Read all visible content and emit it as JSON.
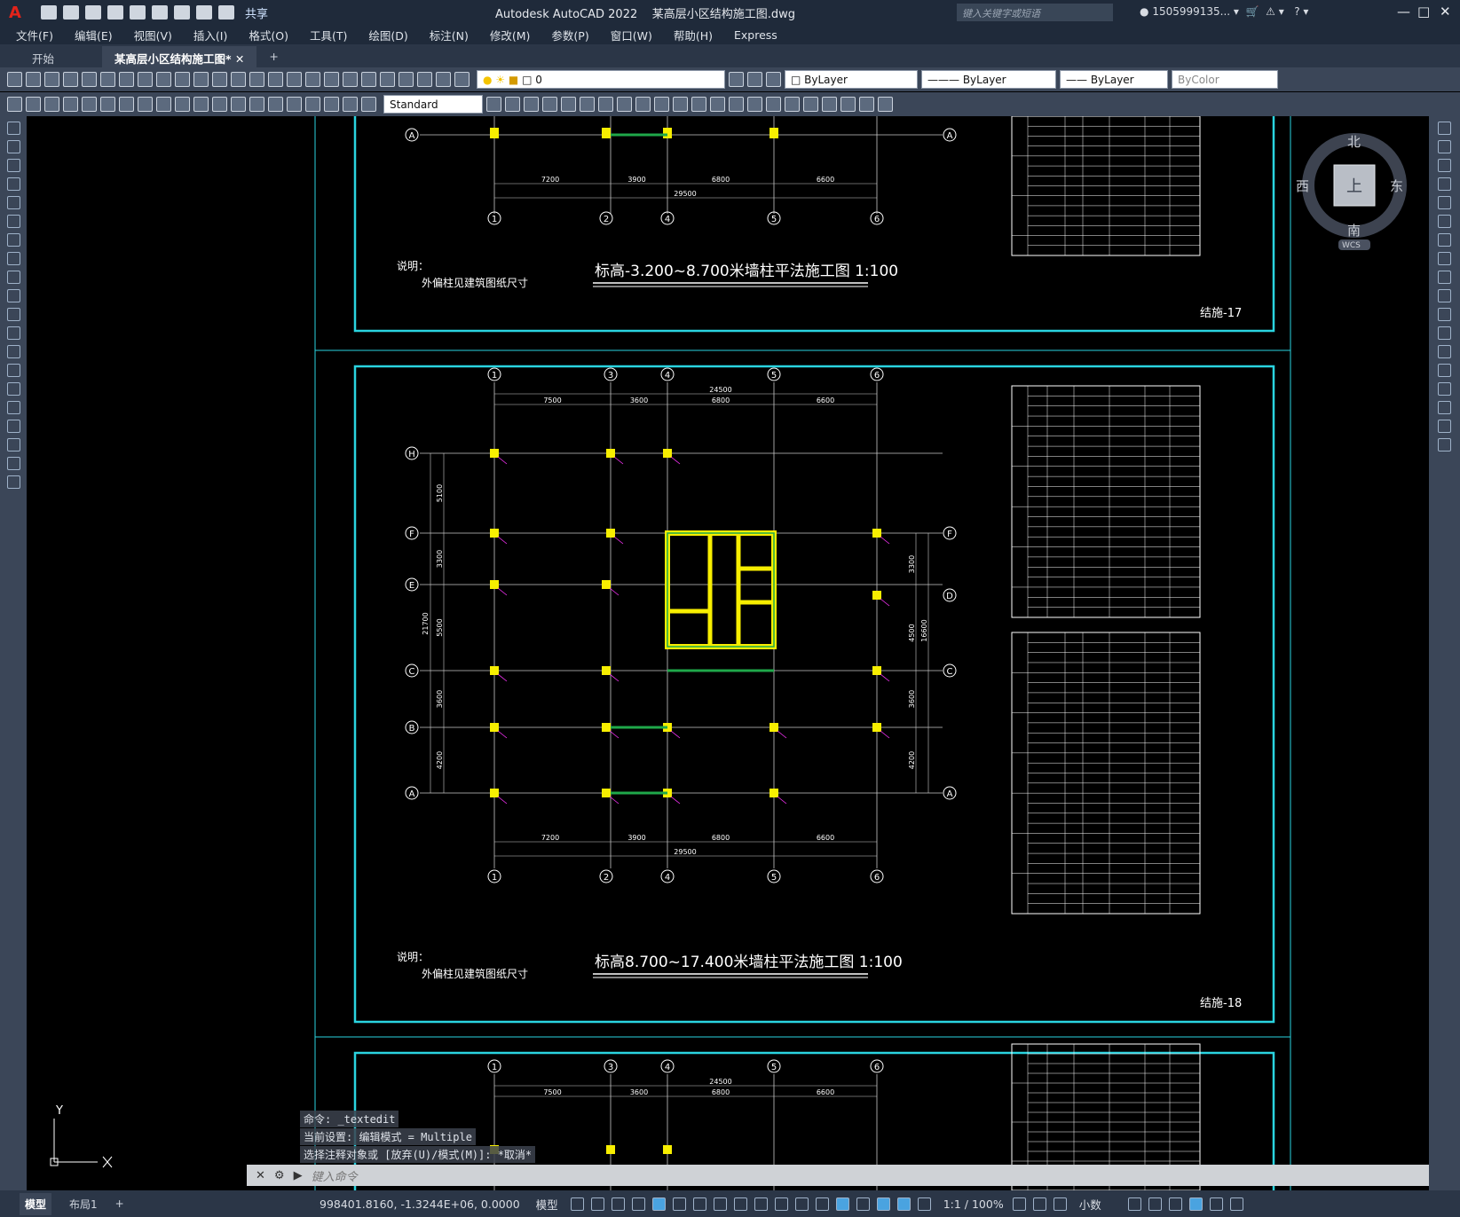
{
  "app": {
    "logo": "A",
    "title": "Autodesk AutoCAD 2022",
    "filename": "某高层小区结构施工图.dwg",
    "share": "共享",
    "search_placeholder": "键入关键字或短语",
    "user": "1505999135...",
    "help": "?"
  },
  "menu": [
    "文件(F)",
    "编辑(E)",
    "视图(V)",
    "插入(I)",
    "格式(O)",
    "工具(T)",
    "绘图(D)",
    "标注(N)",
    "修改(M)",
    "参数(P)",
    "窗口(W)",
    "帮助(H)",
    "Express"
  ],
  "tabs": {
    "start": "开始",
    "doc": "某高层小区结构施工图*",
    "add": "+"
  },
  "toolbar": {
    "layer": "0",
    "color": "ByLayer",
    "linetype": "ByLayer",
    "lineweight": "ByLayer",
    "plotstyle": "ByColor",
    "textstyle": "Standard"
  },
  "viewcube": {
    "north": "北",
    "south": "南",
    "east": "东",
    "west": "西",
    "top": "上",
    "wcs": "WCS"
  },
  "drawing": {
    "sheet1": {
      "title": "标高-3.200~8.700米墙柱平法施工图  1:100",
      "note_label": "说明：",
      "note": "外偏柱见建筑图纸尺寸",
      "sheet_no": "结施-17"
    },
    "sheet2": {
      "title": "标高8.700~17.400米墙柱平法施工图  1:100",
      "note_label": "说明：",
      "note": "外偏柱见建筑图纸尺寸",
      "sheet_no": "结施-18",
      "top_dims": [
        "7500",
        "3600",
        "6800",
        "6600"
      ],
      "top_total": "24500",
      "bottom_dims": [
        "7200",
        "3900",
        "6800",
        "6600"
      ],
      "bottom_total": "29500",
      "left_dims": [
        "5100",
        "3300",
        "5500",
        "3600",
        "4200"
      ],
      "left_total": "21700",
      "right_dims": [
        "3300",
        "4500",
        "3600",
        "4200"
      ],
      "right_total": "16600",
      "col_axes": [
        "1",
        "3",
        "4",
        "5",
        "6"
      ],
      "col_axes_bottom": [
        "1",
        "2",
        "4",
        "5",
        "6"
      ],
      "row_axes_left": [
        "H",
        "F",
        "E",
        "C",
        "B",
        "A"
      ],
      "row_axes_right": [
        "F",
        "D",
        "C",
        "A"
      ]
    },
    "sheet3": {
      "top_dims": [
        "7500",
        "3600",
        "6800",
        "6600"
      ],
      "top_total": "24500",
      "col_axes": [
        "1",
        "3",
        "4",
        "5",
        "6"
      ]
    },
    "axis_y": "Y",
    "axis_x": "X"
  },
  "command": {
    "line1": "命令: _textedit",
    "line2": "当前设置: 编辑模式 = Multiple",
    "line3": "选择注释对象或 [放弃(U)/模式(M)]: *取消*",
    "input_placeholder": "键入命令"
  },
  "layouts": {
    "model": "模型",
    "layout1": "布局1",
    "add": "+"
  },
  "status": {
    "coords": "998401.8160, -1.3244E+06, 0.0000",
    "space": "模型",
    "scale": "1:1 / 100%",
    "units": "小数"
  }
}
